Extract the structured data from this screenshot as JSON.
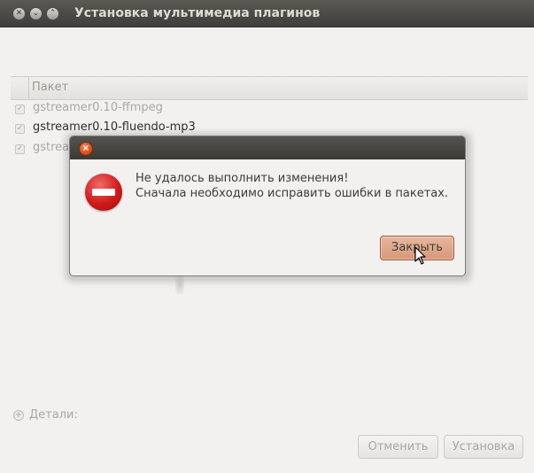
{
  "window": {
    "title": "Установка мультимедиа плагинов",
    "controls": [
      "close",
      "minimize",
      "maximize"
    ]
  },
  "table": {
    "header": "Пакет",
    "rows": [
      {
        "label": "gstreamer0.10-ffmpeg",
        "checked": true
      },
      {
        "label": "gstreamer0.10-fluendo-mp3",
        "checked": true
      },
      {
        "label": "gstrea",
        "checked": true
      }
    ]
  },
  "details": {
    "label": "Детали:"
  },
  "buttons": {
    "cancel": "Отменить",
    "install": "Установка"
  },
  "dialog": {
    "line1": "Не удалось выполнить изменения!",
    "line2": "Сначала необходимо исправить ошибки в пакетах.",
    "close_button": "Закрыть",
    "icon": "error-icon"
  },
  "colors": {
    "titlebar": "#3f3e3a",
    "accent_button": "#d79878",
    "error": "#cf1b1b",
    "close_circle": "#d9501c"
  }
}
